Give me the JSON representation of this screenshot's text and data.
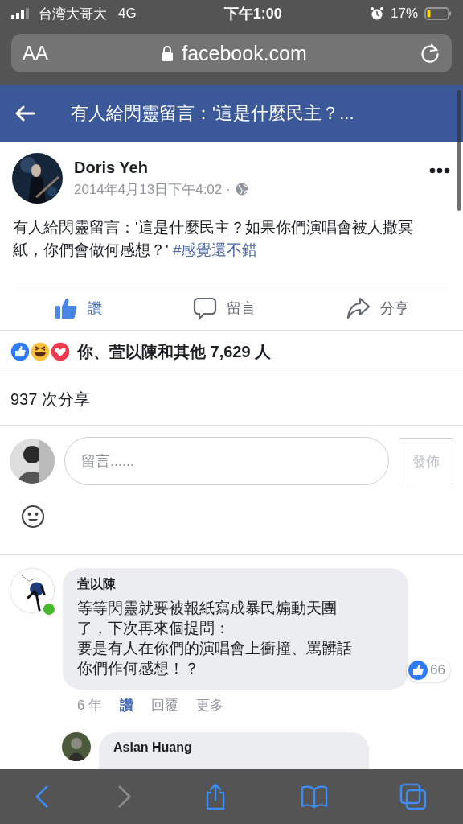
{
  "status_bar": {
    "carrier": "台湾大哥大",
    "network": "4G",
    "time": "下午1:00",
    "battery": "17%"
  },
  "browser": {
    "text_size": "AA",
    "url": "facebook.com"
  },
  "header": {
    "title": "有人給閃靈留言：'這是什麼民主？..."
  },
  "post": {
    "author": "Doris Yeh",
    "timestamp": "2014年4月13日下午4:02 ·",
    "text": "有人給閃靈留言：'這是什麼民主？如果你們演唱會被人撒冥紙，你們會做何感想？' ",
    "hashtag": "#感覺還不錯"
  },
  "actions": [
    {
      "kind": "like",
      "label": "讚",
      "selected": true
    },
    {
      "kind": "comment",
      "label": "留言",
      "selected": false
    },
    {
      "kind": "share",
      "label": "分享",
      "selected": false
    }
  ],
  "reactions": {
    "text": "你、萓以陳和其他 7,629 人"
  },
  "shares": "937 次分享",
  "composer": {
    "placeholder": "留言......",
    "button": "發佈",
    "disabled": true
  },
  "comments": [
    {
      "author": "萓以陳",
      "online": true,
      "lines": [
        "等等閃靈就要被報紙寫成暴民煽動天團",
        "了，下次再來個提問：",
        "要是有人在你們的演唱會上衝撞、罵髒話",
        "你們作何感想！？"
      ],
      "likes": "66",
      "time": "6 年",
      "actions": [
        {
          "label": "讚",
          "selected": true
        },
        {
          "label": "回覆",
          "selected": false
        },
        {
          "label": "更多",
          "selected": false
        }
      ]
    }
  ],
  "reply": {
    "author": "Aslan Huang"
  },
  "toolbar": [
    {
      "kind": "back",
      "disabled": false
    },
    {
      "kind": "forward",
      "disabled": true
    },
    {
      "kind": "share",
      "disabled": false
    },
    {
      "kind": "bookmarks",
      "disabled": false
    },
    {
      "kind": "tabs",
      "disabled": false
    }
  ]
}
